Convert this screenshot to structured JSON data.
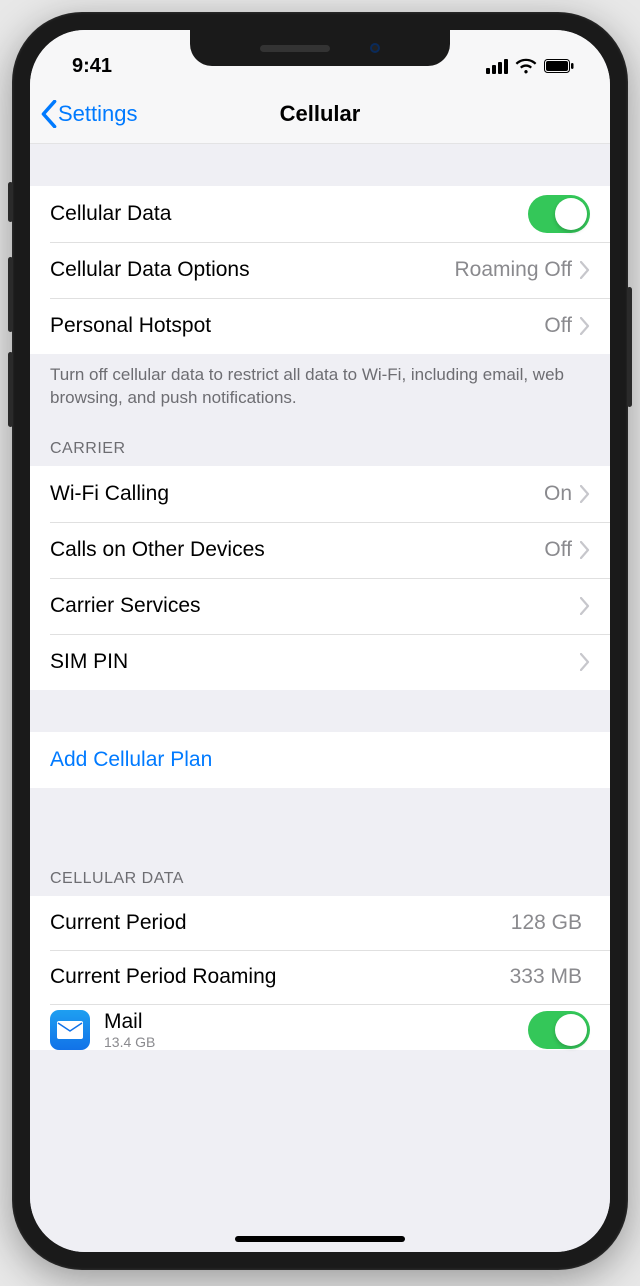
{
  "status": {
    "time": "9:41"
  },
  "nav": {
    "back": "Settings",
    "title": "Cellular"
  },
  "group1": {
    "cellular_data": {
      "label": "Cellular Data",
      "on": true
    },
    "data_options": {
      "label": "Cellular Data Options",
      "value": "Roaming Off"
    },
    "hotspot": {
      "label": "Personal Hotspot",
      "value": "Off"
    },
    "footer": "Turn off cellular data to restrict all data to Wi-Fi, including email, web browsing, and push notifications."
  },
  "carrier": {
    "header": "CARRIER",
    "wifi_calling": {
      "label": "Wi-Fi Calling",
      "value": "On"
    },
    "other_devices": {
      "label": "Calls on Other Devices",
      "value": "Off"
    },
    "services": {
      "label": "Carrier Services"
    },
    "sim_pin": {
      "label": "SIM PIN"
    }
  },
  "add_plan": {
    "label": "Add Cellular Plan"
  },
  "usage": {
    "header": "CELLULAR DATA",
    "current": {
      "label": "Current Period",
      "value": "128 GB"
    },
    "roaming": {
      "label": "Current Period Roaming",
      "value": "333 MB"
    },
    "mail": {
      "label": "Mail",
      "sub": "13.4 GB",
      "on": true
    }
  }
}
